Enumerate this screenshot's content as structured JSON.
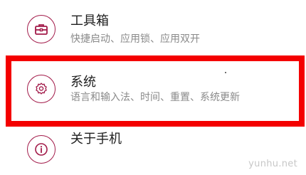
{
  "settings_list": {
    "items": [
      {
        "title": "工具箱",
        "subtitle": "快捷启动、应用锁、应用双开",
        "icon": "toolbox-icon"
      },
      {
        "title": "系统",
        "subtitle": "语言和输入法、时间、重置、系统更新",
        "icon": "gear-icon"
      },
      {
        "title": "关于手机",
        "subtitle": "",
        "icon": "info-icon"
      }
    ]
  },
  "colors": {
    "accent": "#a21a49",
    "highlight": "#f40000",
    "title_text": "#1e1e1e",
    "subtitle_text": "#8a8a8a"
  },
  "watermark": "yunhu.net"
}
